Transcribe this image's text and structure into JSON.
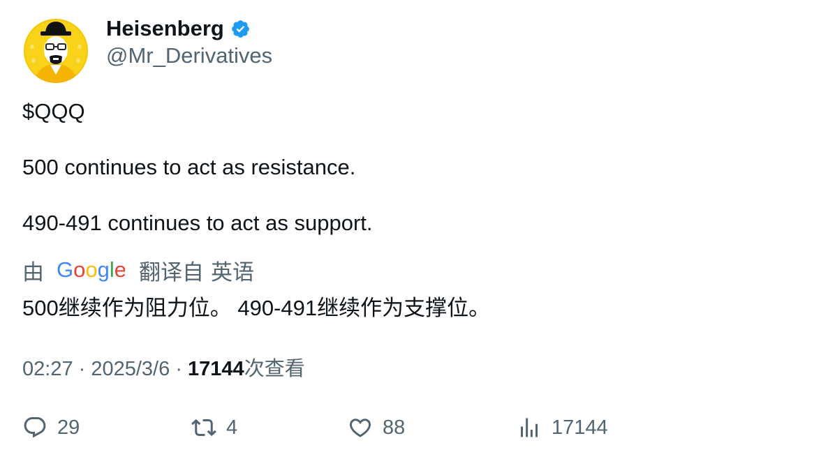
{
  "user": {
    "display_name": "Heisenberg",
    "handle": "@Mr_Derivatives",
    "verified_icon": "verified-badge-icon",
    "avatar_icon": "heisenberg-avatar"
  },
  "tweet": {
    "cashtag": "$QQQ",
    "line1": "500 continues to act as resistance.",
    "line2": "490-491 continues to act as support."
  },
  "translation": {
    "by_label": "由",
    "provider_logo": "google-logo",
    "translated_from_label": "翻译自",
    "language": "英语",
    "text": "500继续作为阻力位。 490-491继续作为支撑位。"
  },
  "meta": {
    "time": "02:27",
    "separator": "·",
    "date": "2025/3/6",
    "views_count": "17144",
    "views_label": "次查看"
  },
  "actions": {
    "replies": "29",
    "retweets": "4",
    "likes": "88",
    "views": "17144"
  },
  "colors": {
    "primary_text": "#0f1419",
    "secondary_text": "#536471",
    "verified_blue": "#1d9bf0",
    "avatar_yellow": "#f7c600"
  }
}
